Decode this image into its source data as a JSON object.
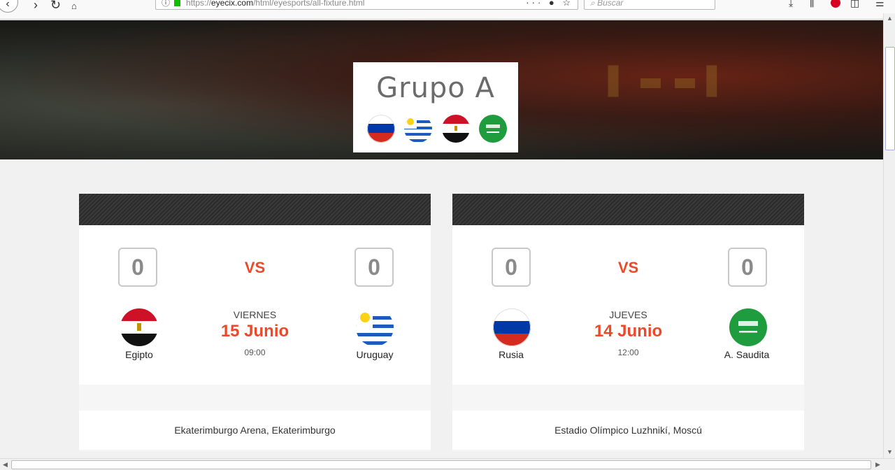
{
  "browser": {
    "url_host": "eyecix.com",
    "url_prefix": "https://",
    "url_path": "/html/eyesports/all-fixture.html",
    "search_placeholder": "Buscar",
    "actions_glyph": "··· ● ☆"
  },
  "hero": {
    "group_title": "Grupo A",
    "flags": [
      "russia-flag",
      "uruguay-flag",
      "egypt-flag",
      "saudi-arabia-flag"
    ]
  },
  "matches": [
    {
      "home": {
        "name": "Egipto",
        "score": "0",
        "flag": "egypt-flag"
      },
      "away": {
        "name": "Uruguay",
        "score": "0",
        "flag": "uruguay-flag"
      },
      "vs": "VS",
      "day": "VIERNES",
      "date": "15 Junio",
      "time": "09:00",
      "venue": "Ekaterimburgo Arena, Ekaterimburgo"
    },
    {
      "home": {
        "name": "Rusia",
        "score": "0",
        "flag": "russia-flag"
      },
      "away": {
        "name": "A. Saudita",
        "score": "0",
        "flag": "saudi-arabia-flag"
      },
      "vs": "VS",
      "day": "JUEVES",
      "date": "14 Junio",
      "time": "12:00",
      "venue": "Estadio Olímpico Luzhnikí, Moscú"
    }
  ],
  "colors": {
    "accent": "#ea4a2a",
    "score_border": "#c8c8c8",
    "card_header": "#2b2b2b"
  }
}
